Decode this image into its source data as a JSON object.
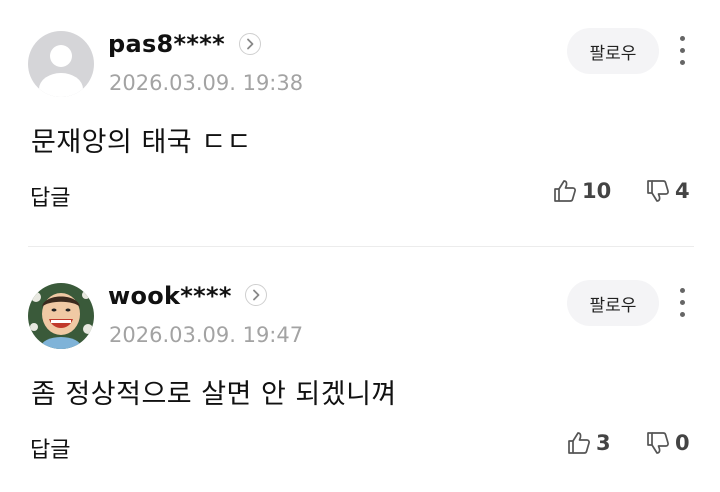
{
  "comments": [
    {
      "username": "pas8****",
      "timestamp": "2026.03.09. 19:38",
      "follow_label": "팔로우",
      "text": "문재앙의 태국 ㄷㄷ",
      "reply_label": "답글",
      "likes": "10",
      "dislikes": "4",
      "avatar": "default-user-icon"
    },
    {
      "username": "wook****",
      "timestamp": "2026.03.09. 19:47",
      "follow_label": "팔로우",
      "text": "좀 정상적으로 살면 안 되겠니껴",
      "reply_label": "답글",
      "likes": "3",
      "dislikes": "0",
      "avatar": "cartoon-face-icon"
    }
  ]
}
